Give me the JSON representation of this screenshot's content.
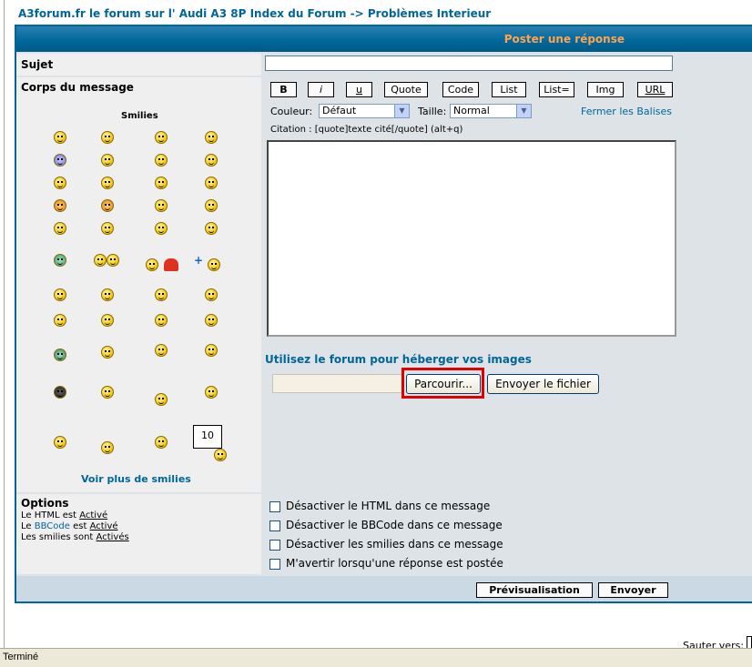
{
  "breadcrumb": {
    "forum": "A3forum.fr le forum sur l' Audi A3 8P Index du Forum",
    "sep": "->",
    "section": "Problèmes Interieur"
  },
  "header": {
    "title": "Poster une réponse"
  },
  "subject": {
    "label": "Sujet",
    "value": ""
  },
  "body": {
    "label": "Corps du message"
  },
  "smilies": {
    "title": "Smilies",
    "more": "Voir plus de smilies"
  },
  "bbcode": {
    "buttons": [
      "B",
      "i",
      "u",
      "Quote",
      "Code",
      "List",
      "List=",
      "Img",
      "URL"
    ],
    "color_label": "Couleur:",
    "color_value": "Défaut",
    "size_label": "Taille:",
    "size_value": "Normal",
    "close_tags": "Fermer les Balises",
    "hint": "Citation : [quote]texte cité[/quote] (alt+q)"
  },
  "upload": {
    "title": "Utilisez le forum pour héberger vos images",
    "browse": "Parcourir...",
    "send": "Envoyer le fichier"
  },
  "options": {
    "title": "Options",
    "html_line": "Le HTML est",
    "html_state": "Activé",
    "bbcode_prefix": "Le",
    "bbcode_link": "BBCode",
    "bbcode_mid": "est",
    "bbcode_state": "Activé",
    "smilies_line": "Les smilies sont",
    "smilies_state": "Activés",
    "checks": [
      "Désactiver le HTML dans ce message",
      "Désactiver le BBCode dans ce message",
      "Désactiver les smilies dans ce message",
      "M'avertir lorsqu'une réponse est postée"
    ]
  },
  "actions": {
    "preview": "Prévisualisation",
    "submit": "Envoyer"
  },
  "footer": {
    "jump": "Sauter vers:"
  },
  "status": {
    "text": "Terminé"
  },
  "colors": {
    "brand": "#006699",
    "header_text": "#ffa34f",
    "highlight": "#e00000"
  }
}
